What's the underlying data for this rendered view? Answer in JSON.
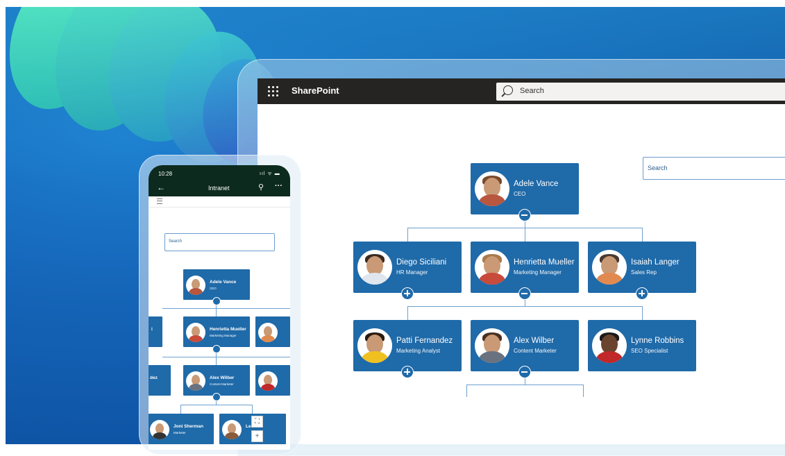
{
  "desktop": {
    "brand": "SharePoint",
    "top_search_placeholder": "Search",
    "org_search_placeholder": "Search",
    "ceo": {
      "name": "Adele Vance",
      "role": "CEO"
    },
    "row2": [
      {
        "name": "Diego Siciliani",
        "role": "HR Manager"
      },
      {
        "name": "Henrietta Mueller",
        "role": "Marketing Manager"
      },
      {
        "name": "Isaiah Langer",
        "role": "Sales Rep"
      }
    ],
    "row3": [
      {
        "name": "Patti Fernandez",
        "role": "Marketing Analyst"
      },
      {
        "name": "Alex Wilber",
        "role": "Content Marketer"
      },
      {
        "name": "Lynne Robbins",
        "role": "SEO Specialist"
      }
    ]
  },
  "phone": {
    "time": "10:28",
    "status_icons": "ııl ᯤ ▬",
    "title": "Intranet",
    "search_placeholder": "Search",
    "ceo": {
      "name": "Adele Vance",
      "role": "CEO"
    },
    "left_fragment_1": "i",
    "mid": {
      "name": "Henrietta Mueller",
      "role": "Marketing Manager"
    },
    "left_fragment_2": "dez",
    "low": {
      "name": "Alex Wilber",
      "role": "Content Marketer"
    },
    "bottom_left": {
      "name": "Joni Sherman",
      "role": "Marketer"
    },
    "bottom_right_fragment": "Le    llow"
  },
  "colors": {
    "card_blue": "#1f6aa9",
    "sharepoint_bar": "#252423",
    "phone_header": "#0d2a1e"
  }
}
